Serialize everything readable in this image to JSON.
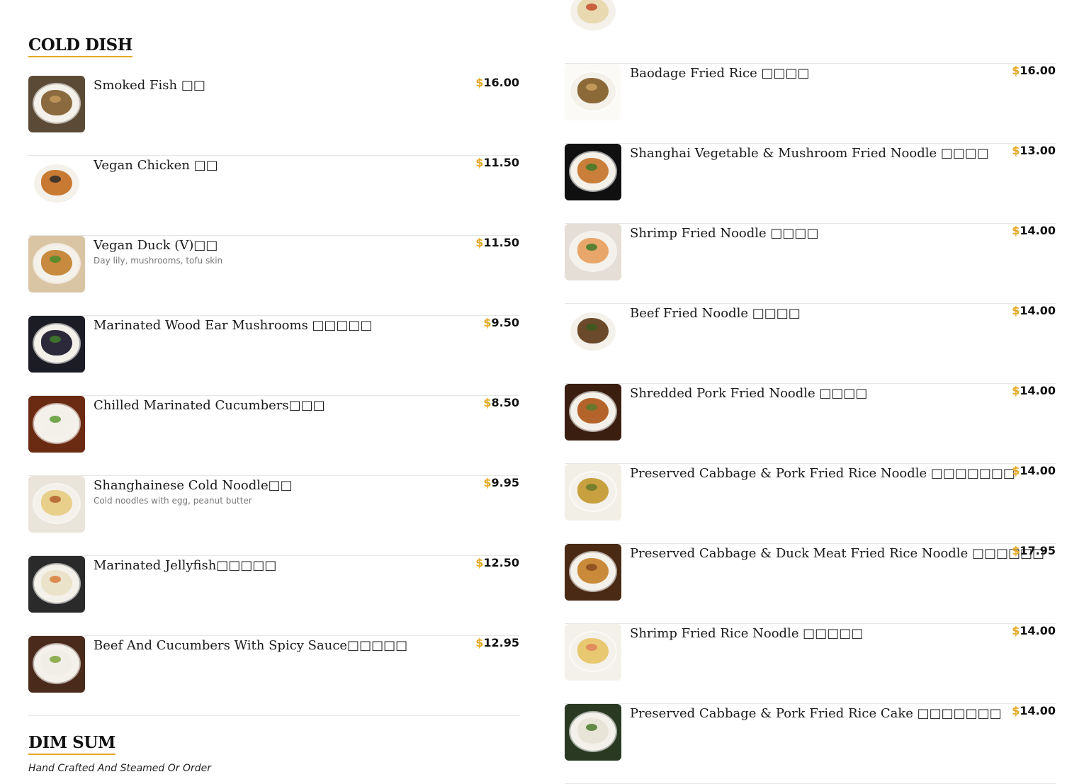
{
  "sections": {
    "cold_dish": {
      "title": "COLD DISH",
      "items": [
        {
          "name": "Smoked Fish □□",
          "description": "",
          "currency": "$",
          "price": "16.00",
          "colors": [
            "#5b4a36",
            "#8a6a3e",
            "#c49a5a"
          ]
        },
        {
          "name": "Vegan Chicken □□",
          "description": "",
          "currency": "$",
          "price": "11.50",
          "colors": [
            "#ffffff",
            "#c97a32",
            "#2b2b2b"
          ]
        },
        {
          "name": "Vegan Duck (V)□□",
          "description": "Day lily, mushrooms, tofu skin",
          "currency": "$",
          "price": "11.50",
          "colors": [
            "#d9c4a4",
            "#c88a3e",
            "#4b8a2c"
          ]
        },
        {
          "name": "Marinated Wood Ear Mushrooms □□□□□",
          "description": "",
          "currency": "$",
          "price": "9.50",
          "colors": [
            "#1c1c24",
            "#2c2a3a",
            "#3f7d2a"
          ]
        },
        {
          "name": "Chilled Marinated Cucumbers□□□",
          "description": "",
          "currency": "$",
          "price": "8.50",
          "colors": [
            "#6b2a12",
            "#f2f0e8",
            "#5d9a33"
          ]
        },
        {
          "name": "Shanghainese Cold Noodle□□",
          "description": "Cold noodles with egg, peanut butter",
          "currency": "$",
          "price": "9.95",
          "colors": [
            "#e9e5da",
            "#e8cf8a",
            "#b3602a"
          ]
        },
        {
          "name": "Marinated Jellyfish□□□□□",
          "description": "",
          "currency": "$",
          "price": "12.50",
          "colors": [
            "#2a2a2a",
            "#ebe3c9",
            "#d97b3c"
          ]
        },
        {
          "name": "Beef And Cucumbers With Spicy Sauce□□□□□",
          "description": "",
          "currency": "$",
          "price": "12.95",
          "colors": [
            "#4a2a1a",
            "#f1eee7",
            "#7fa33a"
          ]
        }
      ]
    },
    "dim_sum": {
      "title": "DIM SUM",
      "subtitle": "Hand Crafted And Steamed Or Order"
    },
    "noodles_rice": {
      "items": [
        {
          "name": "",
          "description": "",
          "currency": "",
          "price": "",
          "colors": [
            "#ffffff",
            "#e9d9b0",
            "#c24b2a"
          ]
        },
        {
          "name": "Baodage Fried Rice □□□□",
          "description": "",
          "currency": "$",
          "price": "16.00",
          "colors": [
            "#fbfaf7",
            "#8c6a38",
            "#c8a060"
          ]
        },
        {
          "name": "Shanghai Vegetable & Mushroom Fried Noodle □□□□",
          "description": "",
          "currency": "$",
          "price": "13.00",
          "colors": [
            "#101010",
            "#c97e3a",
            "#3f7a2a"
          ]
        },
        {
          "name": "Shrimp Fried Noodle □□□□",
          "description": "",
          "currency": "$",
          "price": "14.00",
          "colors": [
            "#e4ded6",
            "#e8a66a",
            "#3f7a2a"
          ]
        },
        {
          "name": "Beef Fried Noodle □□□□",
          "description": "",
          "currency": "$",
          "price": "14.00",
          "colors": [
            "#ffffff",
            "#6a4a2a",
            "#3a5a20"
          ]
        },
        {
          "name": "Shredded Pork Fried Noodle □□□□",
          "description": "",
          "currency": "$",
          "price": "14.00",
          "colors": [
            "#3a1e10",
            "#b4642a",
            "#5a7a2a"
          ]
        },
        {
          "name": "Preserved Cabbage & Pork Fried Rice Noodle □□□□□□□",
          "description": "",
          "currency": "$",
          "price": "14.00",
          "colors": [
            "#f2efe6",
            "#c8a040",
            "#6a7a2a"
          ]
        },
        {
          "name": "Preserved Cabbage & Duck Meat Fried Rice Noodle □□□□□□",
          "description": "",
          "currency": "$",
          "price": "17.95",
          "colors": [
            "#4a2a14",
            "#c98a3a",
            "#8a4a20"
          ]
        },
        {
          "name": "Shrimp Fried Rice Noodle □□□□□",
          "description": "",
          "currency": "$",
          "price": "14.00",
          "colors": [
            "#f4f1ea",
            "#e8c870",
            "#e0825a"
          ]
        },
        {
          "name": "Preserved Cabbage & Pork Fried Rice Cake □□□□□□□",
          "description": "",
          "currency": "$",
          "price": "14.00",
          "colors": [
            "#2a3a22",
            "#e8e4d8",
            "#4a7a2a"
          ]
        }
      ]
    }
  },
  "theme": {
    "accent": "#e5a823",
    "divider": "#e6e6e6",
    "text": "#1a1a1a",
    "muted": "#777777"
  }
}
